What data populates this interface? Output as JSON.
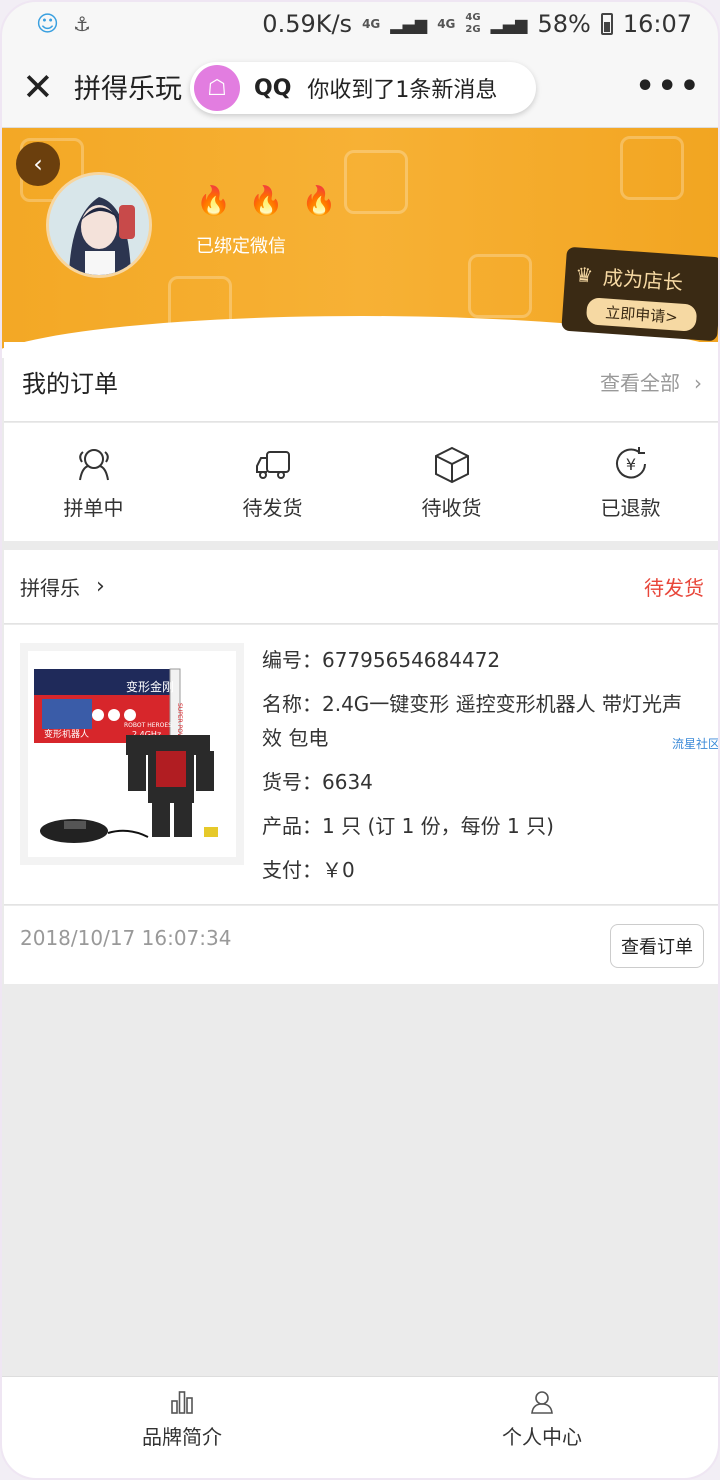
{
  "status_bar": {
    "net_speed": "0.59K/s",
    "net_4g": "4G",
    "net_4g2": "4G",
    "net_4g2g": "4G\n2G",
    "battery": "58%",
    "time": "16:07"
  },
  "title_bar": {
    "title": "拼得乐玩",
    "notification": {
      "app": "QQ",
      "message": "你收到了1条新消息"
    }
  },
  "profile": {
    "bound_text": "已绑定微信",
    "flames": [
      "🔥",
      "🔥",
      "🔥"
    ],
    "shop_card": {
      "title": "成为店长",
      "button": "立即申请>"
    }
  },
  "orders": {
    "title": "我的订单",
    "view_all": "查看全部",
    "tabs": [
      {
        "label": "拼单中",
        "icon": "group-icon"
      },
      {
        "label": "待发货",
        "icon": "truck-icon"
      },
      {
        "label": "待收货",
        "icon": "box-icon"
      },
      {
        "label": "已退款",
        "icon": "refund-icon"
      }
    ]
  },
  "order_card": {
    "shop_name": "拼得乐",
    "status": "待发货",
    "number": "编号：67795654684472",
    "name": "名称：2.4G一键变形 遥控变形机器人 带灯光声效 包电",
    "sku": "货号：6634",
    "product": "产品：1 只 (订 1 份，每份 1 只)",
    "payment": "支付：￥0",
    "watermark": "流星社区",
    "timestamp": "2018/10/17 16:07:34",
    "view_order": "查看订单",
    "image_text": {
      "box_title": "变形金刚",
      "box_sub": "变形机器人",
      "box_freq": "2.4GHz",
      "box_side": "SUPER POWER",
      "box_brand": "ROBOT HEROES"
    }
  },
  "bottom_nav": [
    {
      "label": "品牌简介",
      "icon": "bar-chart-icon"
    },
    {
      "label": "个人中心",
      "icon": "person-icon"
    }
  ],
  "colors": {
    "banner": "#f3a825",
    "status_red": "#e8463a",
    "qq_pink": "#e27de0"
  }
}
